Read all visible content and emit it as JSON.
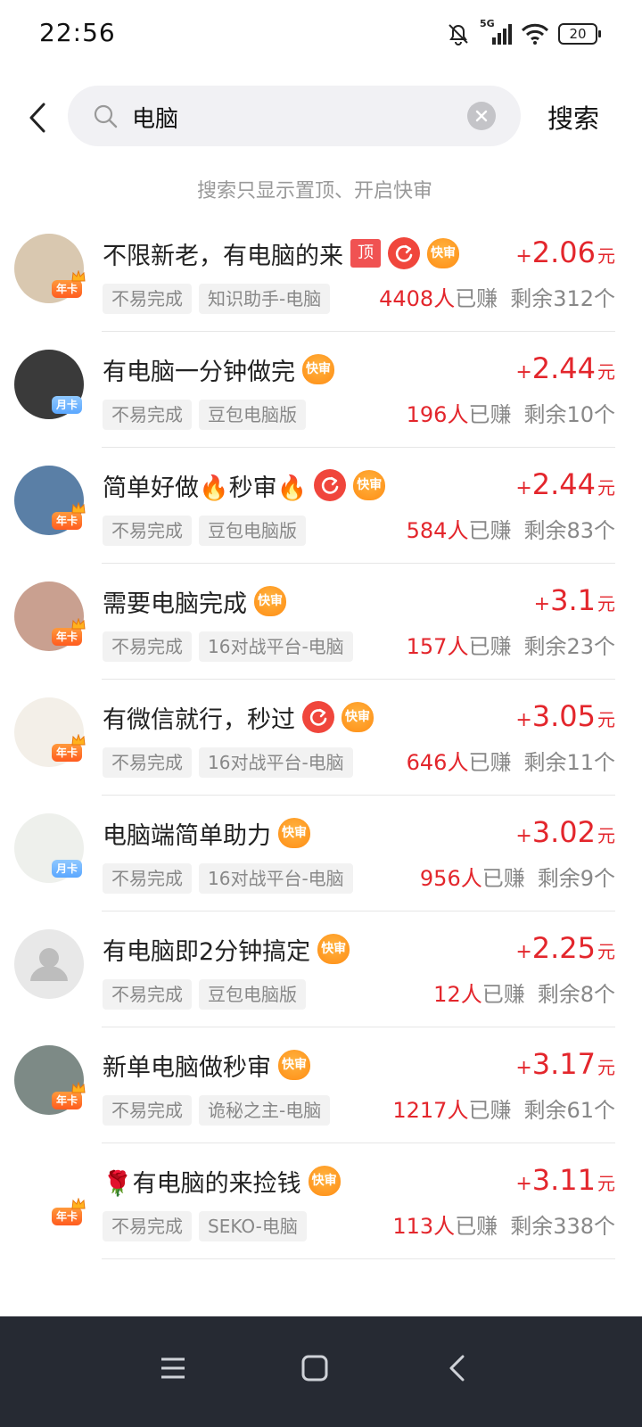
{
  "status_bar": {
    "time": "22:56",
    "network": "5G",
    "battery": "20"
  },
  "search": {
    "query": "电脑",
    "placeholder": "",
    "button_label": "搜索"
  },
  "hint": "搜索只显示置顶、开启快审",
  "badge_labels": {
    "top": "顶",
    "fast": "快审",
    "year_card": "年卡",
    "month_card": "月卡"
  },
  "price_plus": "+",
  "price_unit": "元",
  "earned_label": "已赚",
  "remain_prefix": "剩余",
  "remain_suffix": "个",
  "tasks": [
    {
      "title": "不限新老，有电脑的来",
      "icons": [
        "top",
        "refresh",
        "fast"
      ],
      "price": "2.06",
      "tags": [
        "不易完成",
        "知识助手-电脑"
      ],
      "earned": "4408人",
      "remain": "312",
      "card": "year",
      "avatar_color": "#d9c8b0"
    },
    {
      "title": "有电脑一分钟做完",
      "icons": [
        "fast"
      ],
      "price": "2.44",
      "tags": [
        "不易完成",
        "豆包电脑版"
      ],
      "earned": "196人",
      "remain": "10",
      "card": "month",
      "avatar_color": "#3a3a3a"
    },
    {
      "title": "简单好做🔥秒审🔥",
      "icons": [
        "refresh",
        "fast"
      ],
      "price": "2.44",
      "tags": [
        "不易完成",
        "豆包电脑版"
      ],
      "earned": "584人",
      "remain": "83",
      "card": "year",
      "avatar_color": "#5a7fa6"
    },
    {
      "title": "需要电脑完成",
      "icons": [
        "fast"
      ],
      "price": "3.1",
      "tags": [
        "不易完成",
        "16对战平台-电脑"
      ],
      "earned": "157人",
      "remain": "23",
      "card": "year",
      "avatar_color": "#c9a090"
    },
    {
      "title": "有微信就行，秒过",
      "icons": [
        "refresh",
        "fast"
      ],
      "price": "3.05",
      "tags": [
        "不易完成",
        "16对战平台-电脑"
      ],
      "earned": "646人",
      "remain": "11",
      "card": "year",
      "avatar_color": "#f3efe8"
    },
    {
      "title": "电脑端简单助力",
      "icons": [
        "fast"
      ],
      "price": "3.02",
      "tags": [
        "不易完成",
        "16对战平台-电脑"
      ],
      "earned": "956人",
      "remain": "9",
      "card": "month",
      "avatar_color": "#eef0ec"
    },
    {
      "title": "有电脑即2分钟搞定",
      "icons": [
        "fast"
      ],
      "price": "2.25",
      "tags": [
        "不易完成",
        "豆包电脑版"
      ],
      "earned": "12人",
      "remain": "8",
      "card": "",
      "avatar_color": "#e8e8e8"
    },
    {
      "title": "新单电脑做秒审",
      "icons": [
        "fast"
      ],
      "price": "3.17",
      "tags": [
        "不易完成",
        "诡秘之主-电脑"
      ],
      "earned": "1217人",
      "remain": "61",
      "card": "year",
      "avatar_color": "#7d8a86"
    },
    {
      "title": "🌹有电脑的来捡钱",
      "icons": [
        "fast"
      ],
      "price": "3.11",
      "tags": [
        "不易完成",
        "SEKO-电脑"
      ],
      "earned": "113人",
      "remain": "338",
      "card": "year",
      "avatar_color": "#ffffff"
    }
  ],
  "colors": {
    "accent_red": "#e3262c",
    "fast_badge": "#ff9b20",
    "navbar": "#262a33"
  }
}
